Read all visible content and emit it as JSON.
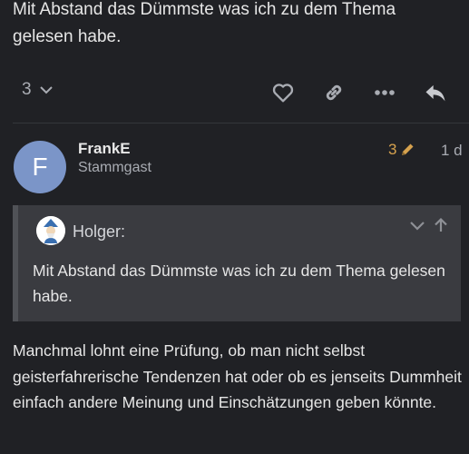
{
  "previous_post": {
    "text": "Mit Abstand das Dümmste was ich zu dem Thema gelesen habe."
  },
  "actions": {
    "like_count": "3",
    "icons": [
      "chevron-down-icon",
      "heart-icon",
      "link-icon",
      "more-icon",
      "reply-icon"
    ]
  },
  "post": {
    "avatar_letter": "F",
    "avatar_color": "#7b95c8",
    "username": "FrankE",
    "user_title": "Stammgast",
    "edit_count": "3",
    "age": "1 d",
    "quote": {
      "author": "Holger:",
      "text": "Mit Abstand das Dümmste was ich zu dem Thema gelesen habe."
    },
    "body": "Manchmal lohnt eine Prüfung, ob man nicht selbst geisterfahrerische Tendenzen hat oder ob es jenseits Dummheit einfach andere Meinung und Einschätzungen geben könnte."
  },
  "colors": {
    "background": "#202125",
    "edit_accent": "#d6a24e",
    "quote_background": "#3a3b40"
  }
}
